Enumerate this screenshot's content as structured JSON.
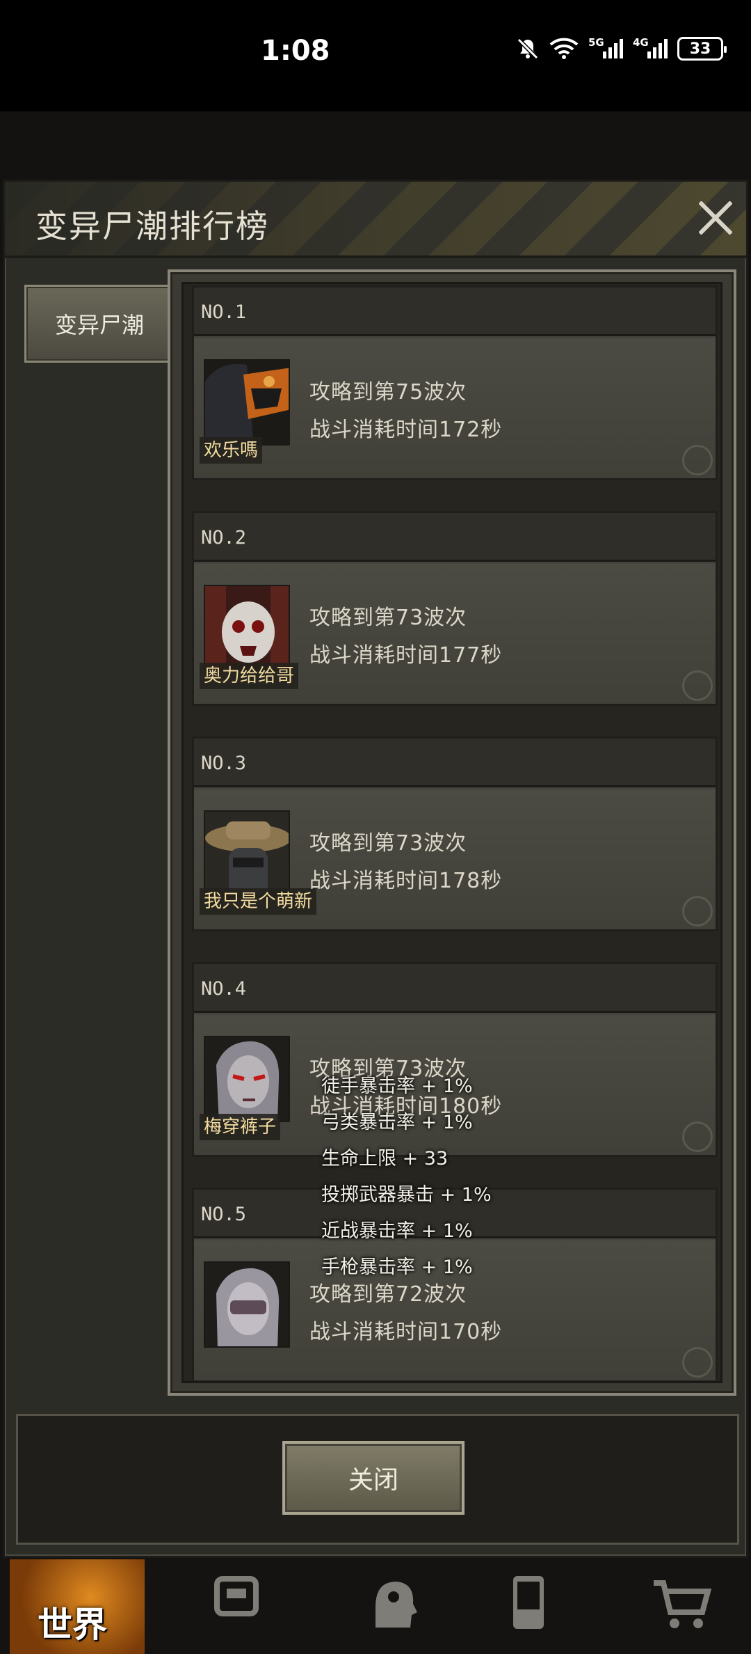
{
  "status_bar": {
    "time": "1:08",
    "net1": "5G",
    "net2": "4G",
    "battery": "33"
  },
  "dialog": {
    "title": "变异尸潮排行榜",
    "tab_label": "变异尸潮",
    "close_button_label": "关闭"
  },
  "ranking": [
    {
      "rank": "NO.1",
      "name": "欢乐嗎",
      "wave_text": "攻略到第75波次",
      "time_text": "战斗消耗时间172秒"
    },
    {
      "rank": "NO.2",
      "name": "奥力给给哥",
      "wave_text": "攻略到第73波次",
      "time_text": "战斗消耗时间177秒"
    },
    {
      "rank": "NO.3",
      "name": "我只是个萌新",
      "wave_text": "攻略到第73波次",
      "time_text": "战斗消耗时间178秒"
    },
    {
      "rank": "NO.4",
      "name": "梅穿裤子",
      "wave_text": "攻略到第73波次",
      "time_text": "战斗消耗时间180秒"
    },
    {
      "rank": "NO.5",
      "name": "",
      "wave_text": "攻略到第72波次",
      "time_text": "战斗消耗时间170秒"
    }
  ],
  "buff_overlay": [
    "徒手暴击率 + 1%",
    "弓类暴击率 + 1%",
    "生命上限 + 33",
    "投掷武器暴击 + 1%",
    "近战暴击率 + 1%",
    "手枪暴击率 + 1%"
  ],
  "bottom_nav": {
    "world_label": "世界",
    "items": [
      "backpack-icon",
      "head-skill-icon",
      "phone-icon",
      "cart-icon"
    ]
  },
  "colors": {
    "panel": "#2c2c27",
    "card": "#44433c",
    "name_text": "#f3dca0",
    "world_orange": "#e08a20"
  }
}
